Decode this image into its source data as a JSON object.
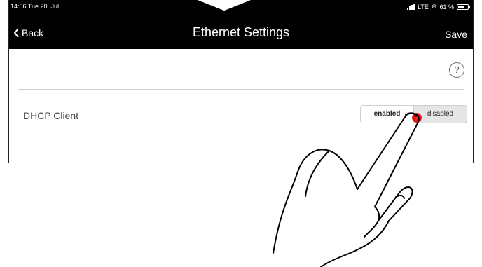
{
  "status_bar": {
    "time_date": "14:56  Tue 20. Jul",
    "network": "LTE",
    "battery": "61 %",
    "battery_level_pct": 61
  },
  "nav_bar": {
    "back_label": "Back",
    "title": "Ethernet Settings",
    "save_label": "Save"
  },
  "content": {
    "help_symbol": "?",
    "dhcp": {
      "label": "DHCP Client",
      "options": [
        "enabled",
        "disabled"
      ],
      "selected": "enabled"
    }
  },
  "colors": {
    "bar_background": "#000000",
    "touch_indicator": "#e60000"
  },
  "icons": [
    "chevron-left-icon",
    "signal-icon",
    "location-icon",
    "battery-icon",
    "help-icon",
    "pointing-hand-icon"
  ]
}
